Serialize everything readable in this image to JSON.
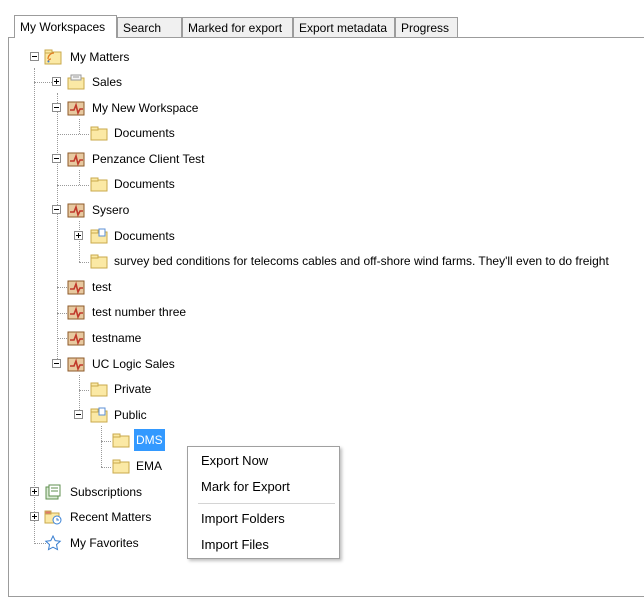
{
  "tabs": [
    {
      "label": "My Workspaces",
      "active": true
    },
    {
      "label": "Search",
      "active": false
    },
    {
      "label": "Marked for export",
      "active": false
    },
    {
      "label": "Export metadata",
      "active": false
    },
    {
      "label": "Progress",
      "active": false
    }
  ],
  "tree": {
    "root": {
      "label": "My Matters",
      "icon": "feed-folder-icon",
      "state": "expanded"
    },
    "nodes": [
      {
        "label": "Sales",
        "icon": "archive-folder-icon",
        "state": "collapsed"
      },
      {
        "label": "My New Workspace",
        "icon": "matter-icon",
        "state": "expanded"
      },
      {
        "label": "Documents",
        "icon": "folder-icon"
      },
      {
        "label": "Penzance Client Test",
        "icon": "matter-icon",
        "state": "expanded"
      },
      {
        "label": "Documents",
        "icon": "folder-icon"
      },
      {
        "label": "Sysero",
        "icon": "matter-icon",
        "state": "expanded"
      },
      {
        "label": "Documents",
        "icon": "folder-icon",
        "state": "collapsed"
      },
      {
        "label": "survey bed conditions for telecoms cables and off-shore wind farms. They'll even to do freight",
        "icon": "folder-icon"
      },
      {
        "label": "test",
        "icon": "matter-icon"
      },
      {
        "label": "test number three",
        "icon": "matter-icon"
      },
      {
        "label": "testname",
        "icon": "matter-icon"
      },
      {
        "label": "UC Logic Sales",
        "icon": "matter-icon",
        "state": "expanded"
      },
      {
        "label": "Private",
        "icon": "folder-icon"
      },
      {
        "label": "Public",
        "icon": "folder-icon",
        "state": "expanded"
      },
      {
        "label": "DMS",
        "icon": "folder-icon",
        "selected": true
      },
      {
        "label": "EMA",
        "icon": "folder-icon"
      }
    ],
    "roots_other": [
      {
        "label": "Subscriptions",
        "icon": "subscriptions-icon",
        "state": "collapsed"
      },
      {
        "label": "Recent Matters",
        "icon": "recent-matters-icon",
        "state": "collapsed"
      },
      {
        "label": "My Favorites",
        "icon": "star-icon"
      }
    ]
  },
  "context_menu": {
    "items": [
      "Export Now",
      "Mark for Export",
      "Import Folders",
      "Import Files"
    ]
  },
  "colors": {
    "selection": "#3399ff",
    "folder": "#fbe9a5",
    "matter": "#c0392b",
    "border": "#9c9c9c"
  }
}
